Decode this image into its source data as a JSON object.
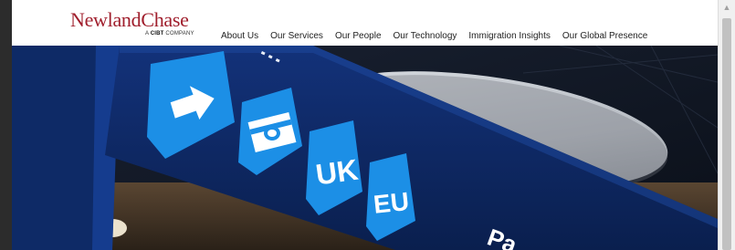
{
  "brand": {
    "name_part1": "Newland",
    "name_part2": "Chase",
    "tagline_prefix": "A ",
    "tagline_bold": "CIBT",
    "tagline_suffix": " COMPANY"
  },
  "nav": {
    "items": [
      {
        "label": "About Us"
      },
      {
        "label": "Our Services"
      },
      {
        "label": "Our People"
      },
      {
        "label": "Our Technology"
      },
      {
        "label": "Immigration Insights"
      },
      {
        "label": "Our Global Presence"
      }
    ]
  },
  "hero": {
    "signs": [
      {
        "label": "→",
        "icon": "arrow-right-icon"
      },
      {
        "label": "",
        "icon": "passport-icon"
      },
      {
        "label": "UK"
      },
      {
        "label": "EU"
      }
    ],
    "partial_text": "Pa",
    "colors": {
      "sign_blue": "#1c8fe6",
      "beam_navy": "#0e2a66",
      "ceiling": "#101826"
    }
  }
}
